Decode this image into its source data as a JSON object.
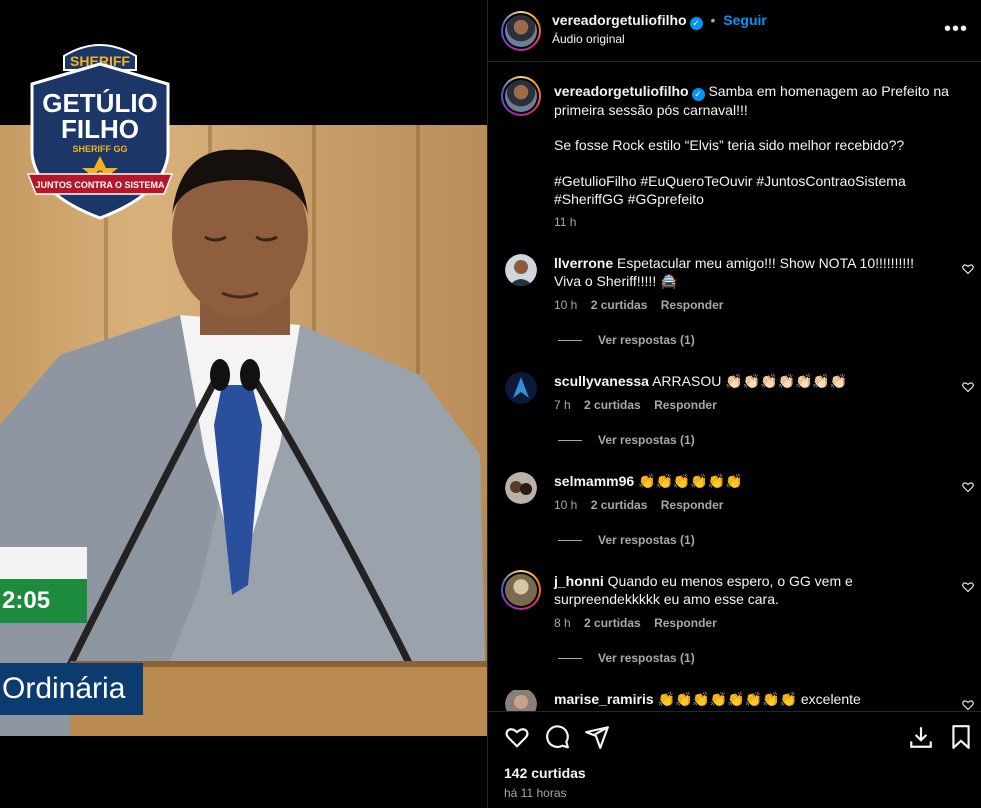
{
  "video": {
    "logo": {
      "top": "SHERIFF",
      "name1": "GETÚLIO",
      "name2": "FILHO",
      "sub": "SHERIFF GG",
      "badge": "G",
      "ribbon": "JUNTOS CONTRA O SISTEMA"
    },
    "clock_text": "2:05",
    "caption_text": "Ordinária"
  },
  "header": {
    "username": "vereadorgetuliofilho",
    "separator": "•",
    "follow_label": "Seguir",
    "audio_label": "Áudio original",
    "more_icon": "more-horizontal-icon"
  },
  "post": {
    "username": "vereadorgetuliofilho",
    "text_line1": "Samba em homenagem ao Prefeito na primeira sessão pós carnaval!!!",
    "text_line2": "Se fosse Rock estilo “Elvis” teria sido melhor recebido??",
    "hashtags": "#GetulioFilho #EuQueroTeOuvir #JuntosContraoSistema #SheriffGG #GGprefeito",
    "time": "11 h"
  },
  "comments": [
    {
      "username": "llverrone",
      "text": "Espetacular meu amigo!!! Show NOTA 10!!!!!!!!!! Viva o Sheriff!!!!! 🚔",
      "time": "10 h",
      "likes": "2 curtidas",
      "reply": "Responder",
      "view_replies": "Ver respostas (1)"
    },
    {
      "username": "scullyvanessa",
      "text": "ARRASOU 👏🏻👏🏻👏🏻👏🏻👏🏻👏🏻👏🏻",
      "time": "7 h",
      "likes": "2 curtidas",
      "reply": "Responder",
      "view_replies": "Ver respostas (1)"
    },
    {
      "username": "selmamm96",
      "text": "👏👏👏👏👏👏",
      "time": "10 h",
      "likes": "2 curtidas",
      "reply": "Responder",
      "view_replies": "Ver respostas (1)"
    },
    {
      "username": "j_honni",
      "text": "Quando eu menos espero, o GG vem e surpreendekkkkk eu amo esse cara.",
      "time": "8 h",
      "likes": "2 curtidas",
      "reply": "Responder",
      "view_replies": "Ver respostas (1)"
    },
    {
      "username": "marise_ramiris",
      "text": "👏👏👏👏👏👏👏👏 excelente"
    }
  ],
  "actions": {
    "likes": "142 curtidas",
    "time_ago": "há 11 horas",
    "icons": [
      "heart-icon",
      "comment-icon",
      "share-icon",
      "download-icon",
      "bookmark-icon"
    ]
  }
}
